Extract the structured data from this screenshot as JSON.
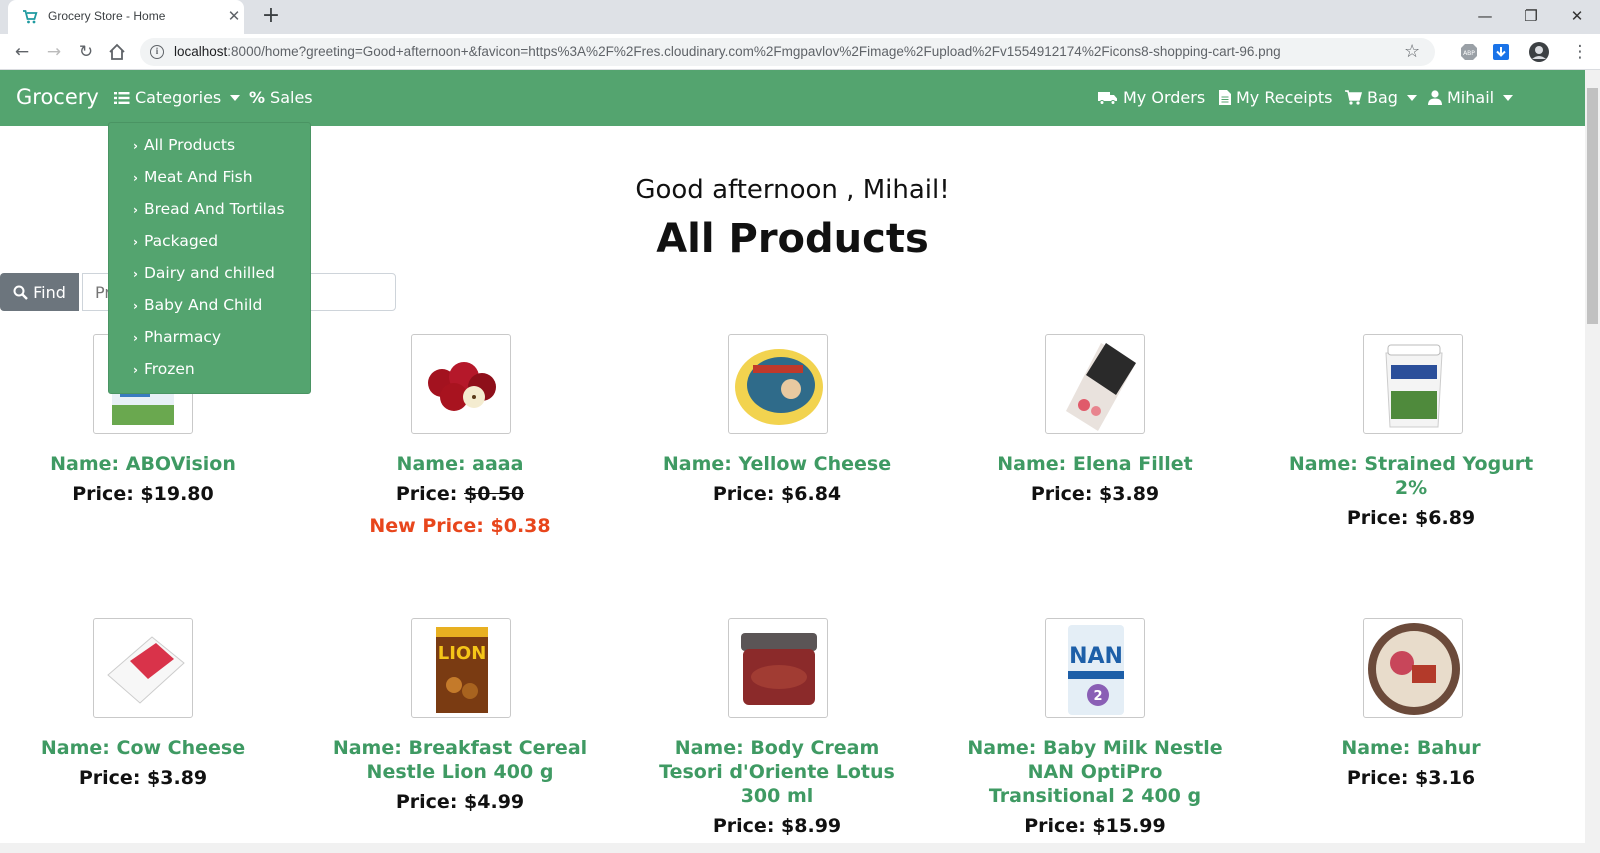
{
  "browser": {
    "tab_title": "Grocery Store - Home",
    "url_host": "localhost",
    "url_rest": ":8000/home?greeting=Good+afternoon+&favicon=https%3A%2F%2Fres.cloudinary.com%2Fmgpavlov%2Fimage%2Fupload%2Fv1554912174%2Ficons8-shopping-cart-96.png"
  },
  "navbar": {
    "brand": "Grocery",
    "categories": "Categories",
    "sales": "Sales",
    "my_orders": "My Orders",
    "my_receipts": "My Receipts",
    "bag": "Bag",
    "user": "Mihail"
  },
  "dropdown": {
    "items": [
      "All Products",
      "Meat And Fish",
      "Bread And Tortilas",
      "Packaged",
      "Dairy and chilled",
      "Baby And Child",
      "Pharmacy",
      "Frozen"
    ]
  },
  "main": {
    "greeting": "Good afternoon , Mihail!",
    "title": "All Products",
    "find_label": "Find",
    "search_placeholder": "Pr"
  },
  "products": [
    {
      "name": "Name: ABOVision",
      "price": "Price: $19.80"
    },
    {
      "name": "Name: aaaa",
      "price_label": "Price:",
      "old_price": "$0.50",
      "new_price": "New Price: $0.38"
    },
    {
      "name": "Name: Yellow Cheese",
      "price": "Price: $6.84"
    },
    {
      "name": "Name: Elena Fillet",
      "price": "Price: $3.89"
    },
    {
      "name_l1": "Name: Strained Yogurt",
      "name_l2": "2%",
      "price": "Price: $6.89"
    },
    {
      "name": "Name: Cow Cheese",
      "price": "Price: $3.89"
    },
    {
      "name_l1": "Name: Breakfast Cereal",
      "name_l2": "Nestle Lion 400 g",
      "price": "Price: $4.99"
    },
    {
      "name_l1": "Name: Body Cream",
      "name_l2": "Tesori d'Oriente Lotus",
      "name_l3": "300 ml",
      "price": "Price: $8.99"
    },
    {
      "name_l1": "Name: Baby Milk Nestle",
      "name_l2": "NAN OptiPro",
      "name_l3": "Transitional 2 400 g",
      "price": "Price: $15.99"
    },
    {
      "name": "Name: Bahur",
      "price": "Price: $3.16"
    }
  ],
  "colors": {
    "nav_green": "#54a46f",
    "product_name": "#3f9a63",
    "new_price": "#e8461c"
  }
}
